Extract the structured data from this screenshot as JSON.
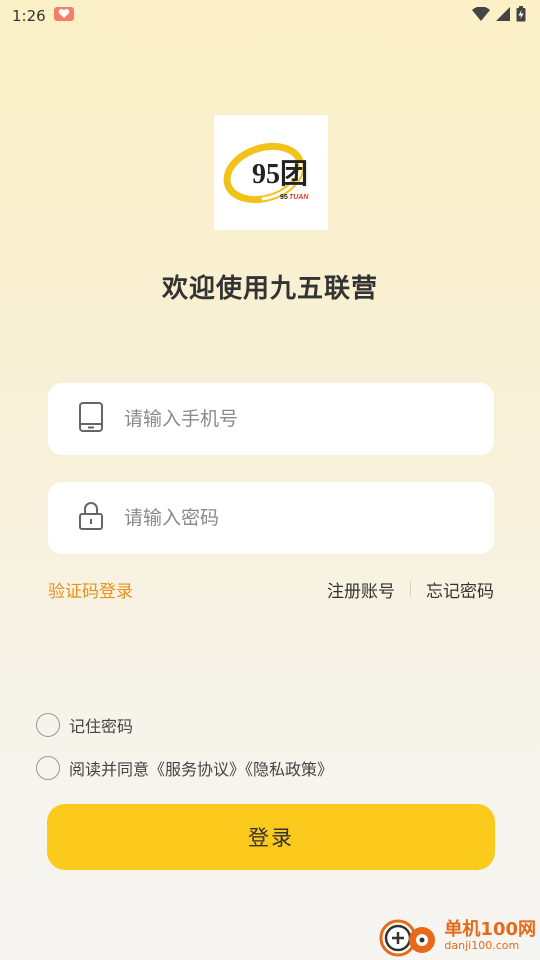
{
  "status_bar": {
    "time": "1:26"
  },
  "logo": {
    "main_text": "95团",
    "sub_number": "95",
    "sub_text": "TUAN"
  },
  "title": "欢迎使用九五联营",
  "phone_field": {
    "placeholder": "请输入手机号",
    "value": ""
  },
  "password_field": {
    "placeholder": "请输入密码",
    "value": ""
  },
  "links": {
    "sms_login": "验证码登录",
    "register": "注册账号",
    "forgot": "忘记密码"
  },
  "remember": {
    "label": "记住密码",
    "checked": false
  },
  "agreement": {
    "label": "阅读并同意《服务协议》《隐私政策》",
    "checked": false
  },
  "login_button": {
    "label": "登录"
  },
  "watermark": {
    "title": "单机100网",
    "url": "danji100.com"
  },
  "colors": {
    "accent": "#fcc91d",
    "link": "#e8911c",
    "bg_top": "#fbf0c6"
  }
}
